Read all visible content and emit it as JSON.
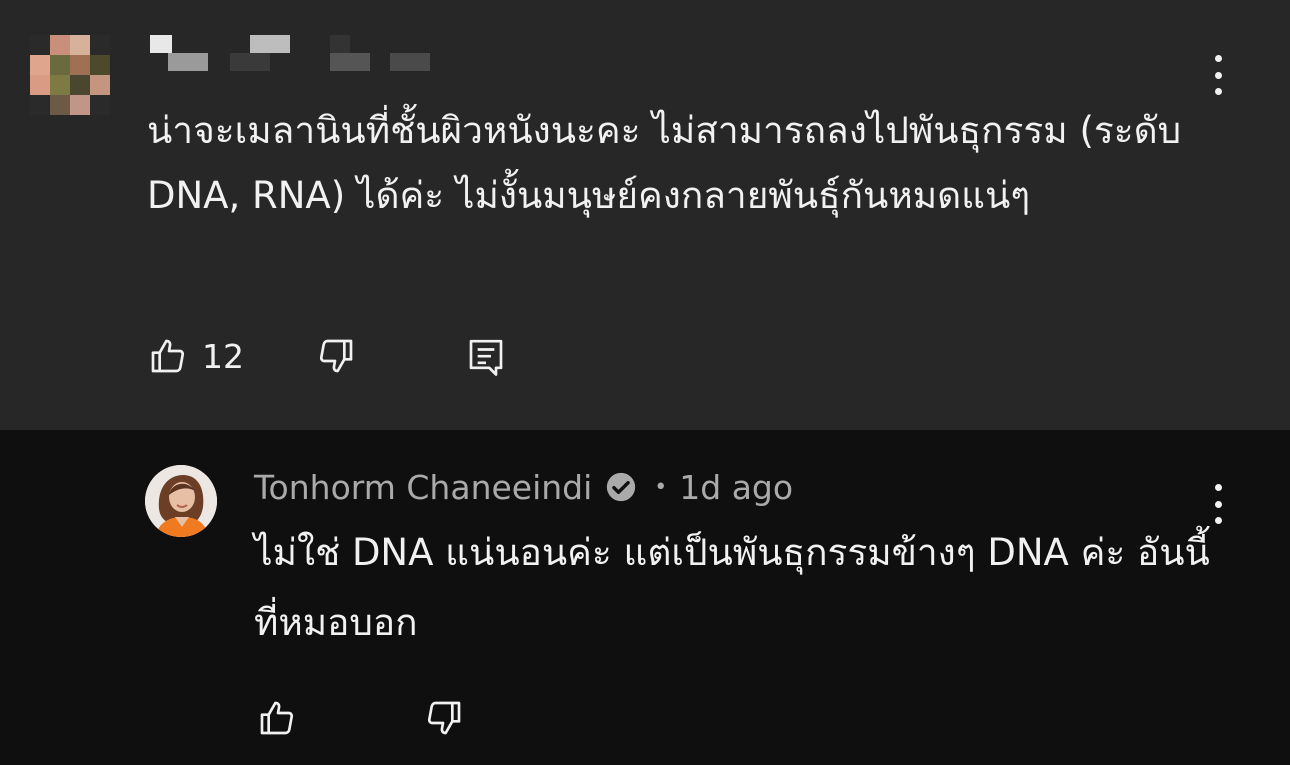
{
  "comment": {
    "text": "น่าจะเมลานินที่ชั้นผิวหนังนะคะ ไม่สามารถลงไปพันธุกรรม (ระดับ DNA, RNA) ได้ค่ะ ไม่งั้นมนุษย์คงกลายพันธุ์กันหมดแน่ๆ",
    "like_count": "12",
    "icons": {
      "like": "thumbs-up-icon",
      "dislike": "thumbs-down-icon",
      "reply": "comment-reply-icon",
      "more": "more-vertical-icon"
    }
  },
  "reply": {
    "author": "Tonhorm Chaneeindi",
    "verified": true,
    "separator": "•",
    "time": "1d ago",
    "text": "ไม่ใช่ DNA แน่นอนค่ะ แต่เป็นพันธุกรรมข้างๆ DNA ค่ะ อันนี้ที่หมอบอก",
    "icons": {
      "like": "thumbs-up-icon",
      "dislike": "thumbs-down-icon",
      "more": "more-vertical-icon",
      "verified": "verified-check-icon"
    }
  },
  "colors": {
    "comment_bg": "#272727",
    "reply_bg": "#0f0f0f",
    "text_primary": "#f1f1f1",
    "text_secondary": "#aaaaaa"
  }
}
